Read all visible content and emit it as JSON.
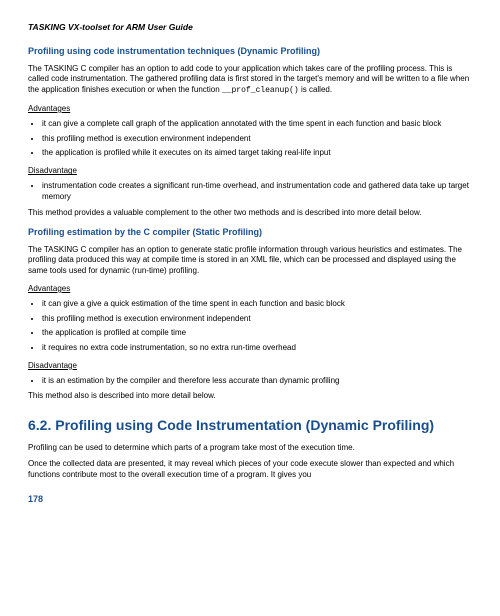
{
  "doc_title": "TASKING VX-toolset for ARM User Guide",
  "s1": {
    "heading": "Profiling using code instrumentation techniques (Dynamic Profiling)",
    "p1a": "The TASKING C compiler has an option to add code to your application which takes care of the profiling process. This is called code instrumentation. The gathered profiling data is first stored in the target's memory and will be written to a file when the application finishes execution or when the function ",
    "p1code": "__prof_cleanup()",
    "p1b": " is called.",
    "adv_label": "Advantages",
    "adv": [
      "it can give a complete call graph of the application annotated with the time spent in each function and basic block",
      "this profiling method is execution environment independent",
      "the application is profiled while it executes on its aimed target taking real-life input"
    ],
    "dis_label": "Disadvantage",
    "dis": [
      "instrumentation code creates a significant run-time overhead, and instrumentation code and gathered data take up target memory"
    ],
    "p2": "This method provides a valuable complement to the other two methods and is described into more detail below."
  },
  "s2": {
    "heading": "Profiling estimation by the C compiler (Static Profiling)",
    "p1": "The TASKING C compiler has an option to generate static profile information through various heuristics and estimates. The profiling data produced this way at compile time is stored in an XML file, which can be processed and displayed using the same tools used for dynamic (run-time) profiling.",
    "adv_label": "Advantages",
    "adv": [
      "it can give a give a quick estimation of the time spent in each function and basic block",
      "this profiling method is execution environment independent",
      "the application is profiled at compile time",
      "it requires no extra code instrumentation, so no extra run-time overhead"
    ],
    "dis_label": "Disadvantage",
    "dis": [
      "it is an estimation by the compiler and therefore less accurate than dynamic profiling"
    ],
    "p2": "This method also is described into more detail below."
  },
  "s3": {
    "heading": "6.2. Profiling using Code Instrumentation (Dynamic Profiling)",
    "p1": "Profiling can be used to determine which parts of a program take most of the execution time.",
    "p2": "Once the collected data are presented, it may reveal which pieces of your code execute slower than expected and which functions contribute most to the overall execution time of a program. It gives you"
  },
  "page_number": "178"
}
